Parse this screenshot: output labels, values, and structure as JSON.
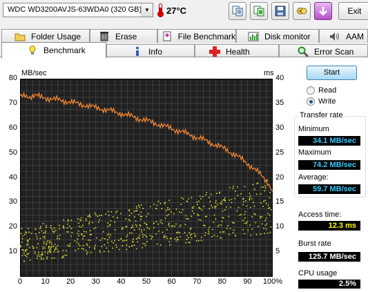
{
  "drive": {
    "selected": "WDC WD3200AVJS-63WDA0 (320 GB)"
  },
  "temperature": {
    "value": "27°C"
  },
  "toolbar": {
    "icons": [
      "copy-text-icon",
      "copy-screenshot-icon",
      "save-icon",
      "options-icon",
      "download-icon"
    ],
    "exit_label": "Exit"
  },
  "tabs": {
    "row1": [
      {
        "label": "Folder Usage",
        "icon": "folder-icon"
      },
      {
        "label": "Erase",
        "icon": "trash-icon"
      },
      {
        "label": "File Benchmark",
        "icon": "file-benchmark-icon"
      },
      {
        "label": "Disk monitor",
        "icon": "disk-monitor-icon"
      },
      {
        "label": "AAM",
        "icon": "speaker-icon"
      }
    ],
    "row2": [
      {
        "label": "Benchmark",
        "icon": "lightbulb-icon",
        "active": true
      },
      {
        "label": "Info",
        "icon": "info-icon"
      },
      {
        "label": "Health",
        "icon": "health-cross-icon"
      },
      {
        "label": "Error Scan",
        "icon": "magnifier-icon"
      }
    ]
  },
  "colors": {
    "transfer_line": "#ff8c32",
    "access_dots": "#e6e633",
    "plot_bg": "#202020",
    "grid": "#505050"
  },
  "chart_data": {
    "type": "line",
    "left_axis": {
      "label": "MB/sec",
      "ticks": [
        "80",
        "70",
        "60",
        "50",
        "40",
        "30",
        "20",
        "10"
      ],
      "ylim": [
        0,
        80
      ]
    },
    "right_axis": {
      "label": "ms",
      "ticks": [
        "40",
        "35",
        "30",
        "25",
        "20",
        "15",
        "10",
        "5"
      ],
      "ylim": [
        0,
        40
      ]
    },
    "x_axis": {
      "ticks": [
        "0",
        "10",
        "20",
        "30",
        "40",
        "50",
        "60",
        "70",
        "80",
        "90",
        "100%"
      ],
      "xlim": [
        0,
        100
      ]
    },
    "grid": true,
    "series": [
      {
        "kind": "transfer-rate",
        "axis": "left",
        "x": [
          0,
          2,
          4,
          6,
          8,
          10,
          12,
          14,
          16,
          18,
          20,
          22,
          24,
          26,
          28,
          30,
          32,
          34,
          36,
          38,
          40,
          42,
          44,
          46,
          48,
          50,
          52,
          54,
          56,
          58,
          60,
          62,
          64,
          66,
          68,
          70,
          72,
          74,
          76,
          78,
          80,
          82,
          84,
          86,
          88,
          90,
          92,
          94,
          96,
          98,
          100
        ],
        "y": [
          72.5,
          73.4,
          72.8,
          73.2,
          72.6,
          72.3,
          71.9,
          71.6,
          71.3,
          70.9,
          70.6,
          70.1,
          69.7,
          69.3,
          68.8,
          68.3,
          67.9,
          67.5,
          67.0,
          66.4,
          66.0,
          65.4,
          64.8,
          64.2,
          63.7,
          63.1,
          62.5,
          61.9,
          61.2,
          60.5,
          59.9,
          59.2,
          58.5,
          57.8,
          57.1,
          56.3,
          55.6,
          54.8,
          53.9,
          53.0,
          52.1,
          51.2,
          49.9,
          48.6,
          47.3,
          45.8,
          44.2,
          42.4,
          40.5,
          38.3,
          34.5
        ]
      },
      {
        "kind": "access-time",
        "axis": "right",
        "style": "scatter",
        "approx_range_ms": [
          3,
          21
        ]
      }
    ]
  },
  "controls": {
    "start_label": "Start",
    "read_label": "Read",
    "write_label": "Write",
    "selected_mode": "Write"
  },
  "transfer_rate": {
    "group_label": "Transfer rate",
    "minimum_label": "Minimum",
    "minimum_value": "34.1 MB/sec",
    "maximum_label": "Maximum",
    "maximum_value": "74.2 MB/sec",
    "average_label": "Average:",
    "average_value": "59.7 MB/sec"
  },
  "access_time": {
    "label": "Access time:",
    "value": "12.3 ms"
  },
  "burst_rate": {
    "label": "Burst rate",
    "value": "125.7 MB/sec"
  },
  "cpu_usage": {
    "label": "CPU usage",
    "value": "2.5%"
  }
}
